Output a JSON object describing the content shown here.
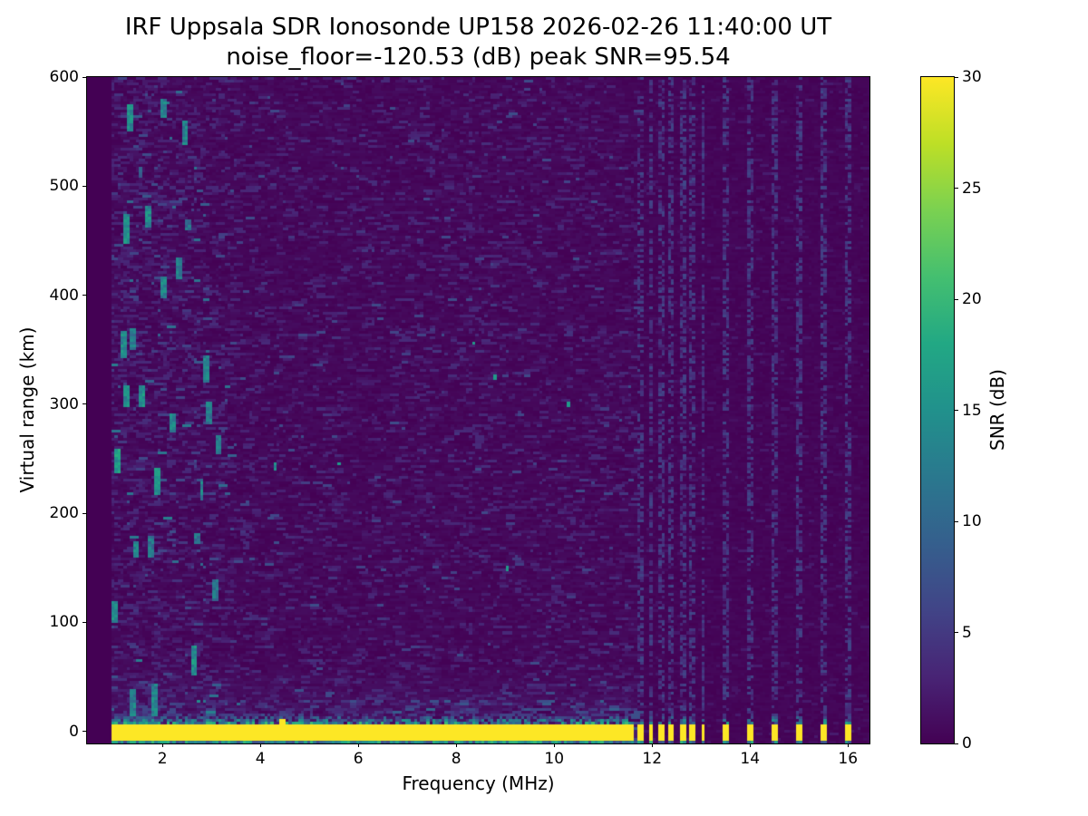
{
  "figure": {
    "title_line1": "IRF Uppsala SDR Ionosonde UP158 2026-02-26 11:40:00  UT",
    "title_line2": "noise_floor=-120.53 (dB) peak SNR=95.54",
    "xlabel": "Frequency (MHz)",
    "ylabel": "Virtual range (km)",
    "colorbar_label": "SNR (dB)"
  },
  "chart_data": {
    "type": "heatmap",
    "title": "IRF Uppsala SDR Ionosonde UP158 2026-02-26 11:40:00 UT / noise_floor=-120.53 (dB) peak SNR=95.54",
    "station": "UP158",
    "timestamp_ut": "2026-02-26 11:40:00",
    "noise_floor_db": -120.53,
    "peak_snr_db": 95.54,
    "xlabel": "Frequency (MHz)",
    "ylabel": "Virtual range (km)",
    "xlim": [
      0.46,
      16.44
    ],
    "ylim": [
      -11,
      600
    ],
    "x_ticks": [
      2,
      4,
      6,
      8,
      10,
      12,
      14,
      16
    ],
    "y_ticks": [
      0,
      100,
      200,
      300,
      400,
      500,
      600
    ],
    "grid": false,
    "colorbar": {
      "label": "SNR (dB)",
      "ticks": [
        0,
        5,
        10,
        15,
        20,
        25,
        30
      ],
      "vmin": 0,
      "vmax": 30,
      "colormap": "viridis",
      "position": "right"
    },
    "colormap_stops": [
      [
        0.0,
        "#440154"
      ],
      [
        0.1,
        "#482475"
      ],
      [
        0.2,
        "#414487"
      ],
      [
        0.3,
        "#355f8d"
      ],
      [
        0.4,
        "#2a788e"
      ],
      [
        0.5,
        "#21918c"
      ],
      [
        0.6,
        "#22a884"
      ],
      [
        0.7,
        "#44bf70"
      ],
      [
        0.8,
        "#7ad151"
      ],
      [
        0.9,
        "#bddf26"
      ],
      [
        1.0,
        "#fde725"
      ]
    ],
    "ground_band": {
      "freq_range_mhz": [
        0.97,
        11.65
      ],
      "range_km": [
        -8,
        6
      ],
      "snr_db": 30
    },
    "ground_band_segments_mhz": [
      11.76,
      11.97,
      12.18,
      12.4,
      12.62,
      12.83,
      13.05,
      13.49,
      14.0,
      14.5,
      15.0,
      15.52,
      16.02
    ],
    "faint_stripes_mhz": [
      8.3
    ],
    "band_bump": {
      "freq_range_mhz": [
        4.42,
        4.53
      ],
      "top_km": 12
    },
    "echoes": [
      [
        1.33,
        550,
        576,
        14
      ],
      [
        2.0,
        562,
        579,
        13
      ],
      [
        2.44,
        538,
        559,
        13
      ],
      [
        1.29,
        447,
        474,
        15
      ],
      [
        1.72,
        462,
        482,
        14
      ],
      [
        2.31,
        414,
        434,
        13
      ],
      [
        2.04,
        397,
        416,
        13
      ],
      [
        1.22,
        342,
        368,
        14
      ],
      [
        1.42,
        350,
        370,
        13
      ],
      [
        1.26,
        297,
        318,
        14
      ],
      [
        1.61,
        297,
        318,
        15
      ],
      [
        2.22,
        275,
        293,
        13
      ],
      [
        2.91,
        319,
        345,
        13
      ],
      [
        2.96,
        283,
        301,
        12
      ],
      [
        3.13,
        254,
        272,
        13
      ],
      [
        1.09,
        237,
        260,
        16
      ],
      [
        1.92,
        217,
        243,
        15
      ],
      [
        2.8,
        213,
        231,
        13
      ],
      [
        4.3,
        239,
        248,
        14
      ],
      [
        1.48,
        159,
        175,
        13
      ],
      [
        1.79,
        160,
        179,
        12
      ],
      [
        1.02,
        100,
        119,
        14
      ],
      [
        2.63,
        52,
        79,
        15
      ],
      [
        1.41,
        13,
        40,
        13
      ],
      [
        1.83,
        15,
        44,
        13
      ],
      [
        3.09,
        119,
        140,
        11
      ],
      [
        2.7,
        171,
        183,
        11
      ],
      [
        2.52,
        461,
        470,
        11
      ],
      [
        1.55,
        508,
        518,
        11
      ]
    ],
    "bright_dots": [
      [
        8.8,
        325
      ],
      [
        8.35,
        356
      ],
      [
        9.05,
        150
      ],
      [
        10.3,
        300
      ],
      [
        5.6,
        246
      ]
    ],
    "render": {
      "seed": 1234,
      "ncols": 256,
      "nrows": 244,
      "data_start_mhz": 0.97,
      "segment_halfwidth_mhz": 0.05,
      "faint_stripe_halfwidth_mhz": 0.05,
      "echo_halfwidth_mhz": 0.06
    }
  }
}
